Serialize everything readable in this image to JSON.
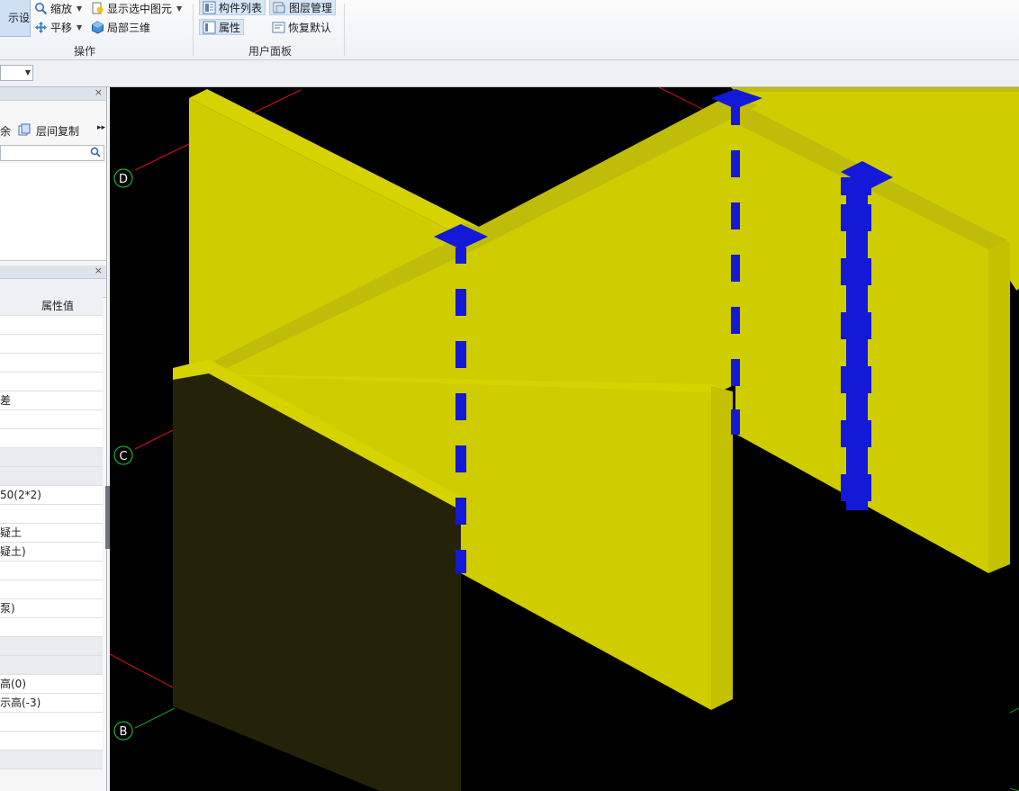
{
  "ribbon": {
    "big_button_label": "示设置",
    "zoom_label": "缩放",
    "pan_label": "平移",
    "show_selected_label": "显示选中图元",
    "local_3d_label": "局部三维",
    "group_operations_label": "操作",
    "component_list_label": "构件列表",
    "layer_manage_label": "图层管理",
    "properties_label": "属性",
    "restore_default_label": "恢复默认",
    "group_user_panel_label": "用户面板"
  },
  "left_panel": {
    "delete_partial": "余",
    "copy_between_floors_label": "层间复制",
    "prop_header_value": "属性值",
    "prop_rows": [
      "",
      "",
      "",
      "",
      "差",
      "",
      "",
      "",
      "",
      "50(2*2)",
      "",
      "疑土",
      "疑土)",
      "",
      "",
      "泵)",
      "",
      "",
      "",
      "高(0)",
      "示高(-3)",
      "",
      "",
      ""
    ],
    "grey_rows": [
      7,
      8,
      17,
      18,
      23
    ]
  },
  "viewport": {
    "axis_labels": [
      "D",
      "C",
      "B"
    ],
    "colors": {
      "background": "#000000",
      "wall_light": "#cfcc00",
      "wall_top": "#bfbd0a",
      "wall_dark": "#24230a",
      "rebar": "#1419d8",
      "grid_red": "#e01010",
      "grid_green": "#1a9a2a",
      "axis_green": "#1db02e"
    }
  }
}
